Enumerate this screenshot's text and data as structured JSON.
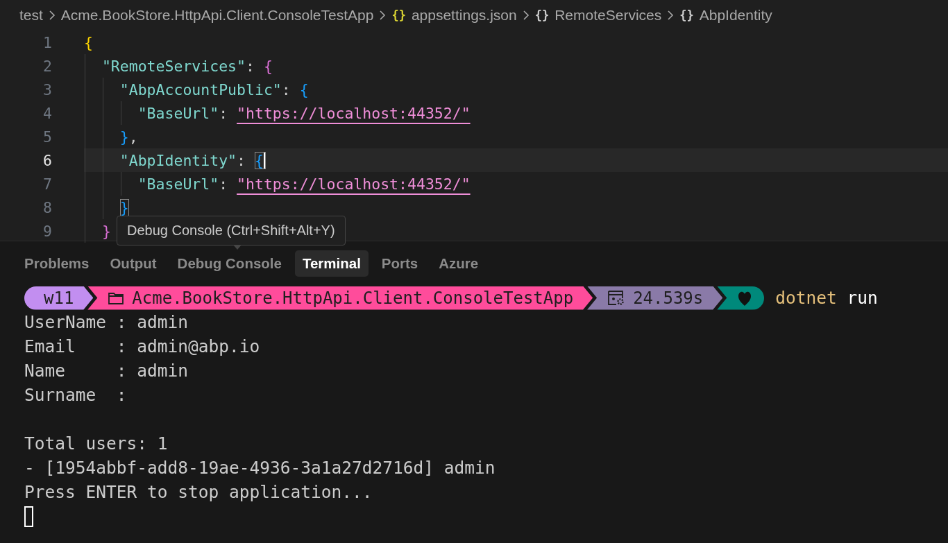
{
  "breadcrumb": [
    {
      "label": "test",
      "kind": "folder"
    },
    {
      "label": "Acme.BookStore.HttpApi.Client.ConsoleTestApp",
      "kind": "folder"
    },
    {
      "label": "appsettings.json",
      "kind": "json-file",
      "icon": "{}"
    },
    {
      "label": "RemoteServices",
      "kind": "object",
      "icon": "{}"
    },
    {
      "label": "AbpIdentity",
      "kind": "object",
      "icon": "{}"
    }
  ],
  "editor": {
    "lines": [
      {
        "number": "1",
        "current": false,
        "tokens": [
          {
            "text": "{",
            "kind": "brace1"
          }
        ]
      },
      {
        "number": "2",
        "current": false,
        "tokens": [
          {
            "text": "  \"RemoteServices\"",
            "kind": "key"
          },
          {
            "text": ": ",
            "kind": "punct"
          },
          {
            "text": "{",
            "kind": "brace2"
          }
        ]
      },
      {
        "number": "3",
        "current": false,
        "tokens": [
          {
            "text": "    \"AbpAccountPublic\"",
            "kind": "key"
          },
          {
            "text": ": ",
            "kind": "punct"
          },
          {
            "text": "{",
            "kind": "brace3"
          }
        ]
      },
      {
        "number": "4",
        "current": false,
        "tokens": [
          {
            "text": "      \"BaseUrl\"",
            "kind": "key"
          },
          {
            "text": ": ",
            "kind": "punct"
          },
          {
            "text": "\"https://localhost:44352/\"",
            "kind": "link"
          }
        ]
      },
      {
        "number": "5",
        "current": false,
        "tokens": [
          {
            "text": "    }",
            "kind": "brace3"
          },
          {
            "text": ",",
            "kind": "punct"
          }
        ]
      },
      {
        "number": "6",
        "current": true,
        "tokens": [
          {
            "text": "    \"AbpIdentity\"",
            "kind": "key"
          },
          {
            "text": ": ",
            "kind": "punct"
          },
          {
            "text": "{",
            "kind": "brace3",
            "matched": true,
            "cursor": true
          }
        ]
      },
      {
        "number": "7",
        "current": false,
        "tokens": [
          {
            "text": "      \"BaseUrl\"",
            "kind": "key"
          },
          {
            "text": ": ",
            "kind": "punct"
          },
          {
            "text": "\"https://localhost:44352/\"",
            "kind": "link"
          }
        ]
      },
      {
        "number": "8",
        "current": false,
        "tokens": [
          {
            "text": "    }",
            "kind": "brace3",
            "matched": true
          }
        ]
      },
      {
        "number": "9",
        "current": false,
        "tokens": [
          {
            "text": "  }",
            "kind": "brace2"
          }
        ]
      }
    ]
  },
  "tooltip": {
    "text": "Debug Console (Ctrl+Shift+Alt+Y)"
  },
  "panel_tabs": [
    {
      "label": "Problems",
      "selected": false
    },
    {
      "label": "Output",
      "selected": false
    },
    {
      "label": "Debug Console",
      "selected": false
    },
    {
      "label": "Terminal",
      "selected": true
    },
    {
      "label": "Ports",
      "selected": false
    },
    {
      "label": "Azure",
      "selected": false
    }
  ],
  "terminal": {
    "prompt": [
      {
        "kind": "user",
        "text": "w11",
        "color": "#c28ef0"
      },
      {
        "kind": "path",
        "text": "Acme.BookStore.HttpApi.Client.ConsoleTestApp",
        "color": "#ff4c9b"
      },
      {
        "kind": "duration",
        "text": "24.539s",
        "color": "#8a7aa8"
      },
      {
        "kind": "status",
        "color": "#00897b"
      }
    ],
    "command": {
      "program": "dotnet",
      "args": "run"
    },
    "output_blocks": [
      [
        "UserName : admin",
        "Email    : admin@abp.io",
        "Name     : admin",
        "Surname  :"
      ],
      [
        "Total users: 1",
        "- [1954abbf-add8-19ae-4936-3a1a27d2716d] admin",
        "Press ENTER to stop application..."
      ]
    ]
  }
}
